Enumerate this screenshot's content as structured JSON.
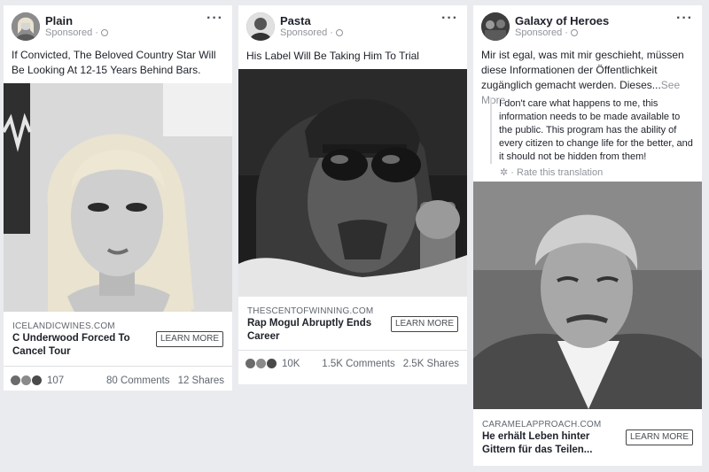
{
  "cards": [
    {
      "page_name": "Plain",
      "sponsored": "Sponsored ·",
      "body": "If Convicted, The Beloved Country Star Will Be Looking At 12-15 Years Behind Bars.",
      "domain": "ICELANDICWINES.COM",
      "headline": "C Underwood Forced To Cancel Tour",
      "cta": "LEARN MORE",
      "reactions": "107",
      "comments": "80 Comments",
      "shares": "12 Shares"
    },
    {
      "page_name": "Pasta",
      "sponsored": "Sponsored ·",
      "body": "His Label Will Be Taking Him To Trial",
      "domain": "THESCENTOFWINNING.COM",
      "headline": "Rap Mogul Abruptly Ends Career",
      "cta": "LEARN MORE",
      "reactions": "10K",
      "comments": "1.5K Comments",
      "shares": "2.5K Shares"
    },
    {
      "page_name": "Galaxy of Heroes",
      "sponsored": "Sponsored ·",
      "body": "Mir ist egal, was mit mir geschieht, müssen diese Informationen der Öffentlichkeit zugänglich gemacht werden. Dieses...",
      "see_more": "See More",
      "translation": "I don't care what happens to me, this information needs to be made available to the public. This program has the ability of every citizen to change life for the better, and it should not be hidden from them!",
      "rate_translation": "· Rate this translation",
      "domain": "CARAMELAPPROACH.COM",
      "headline": "He erhält Leben hinter Gittern für das Teilen...",
      "cta": "LEARN MORE"
    }
  ],
  "icons": {
    "more": "more-options-icon",
    "globe": "globe-icon",
    "gear": "gear-icon",
    "like": "like-reaction-icon",
    "wow": "wow-reaction-icon",
    "sad": "sad-reaction-icon"
  },
  "colors": {
    "background": "#e9ebee",
    "card": "#ffffff",
    "text": "#1d2129",
    "muted": "#90949c"
  }
}
